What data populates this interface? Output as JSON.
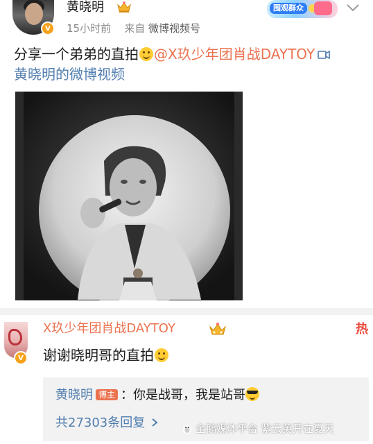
{
  "post": {
    "username": "黄晓明",
    "time": "15小时前",
    "source_prefix": "来自",
    "source": "微博视频号",
    "promo_badge": "围观群众",
    "text_prefix": "分享一个弟弟的直拍",
    "mention": "@X玖少年团肖战DAYTOY",
    "video_link_label": "黄晓明的微博视频"
  },
  "comment": {
    "username": "X玖少年团肖战DAYTOY",
    "hot_label": "热",
    "text": "谢谢晓明哥的直拍",
    "reply": {
      "author": "黄晓明",
      "author_tag": "博主",
      "text": "：你是战哥，我是站哥"
    },
    "reply_count_label": "共27303条回复"
  },
  "watermark": "企鹅媒体平台 紫云英开在夏天",
  "colors": {
    "link_orange": "#eb7350",
    "link_blue": "#507daf",
    "verify_badge": "#f7a21b"
  },
  "icons": [
    "crown-icon",
    "chevron-down-icon",
    "video-icon",
    "chevron-right-icon",
    "smile-emoji-icon",
    "cool-emoji-icon"
  ]
}
